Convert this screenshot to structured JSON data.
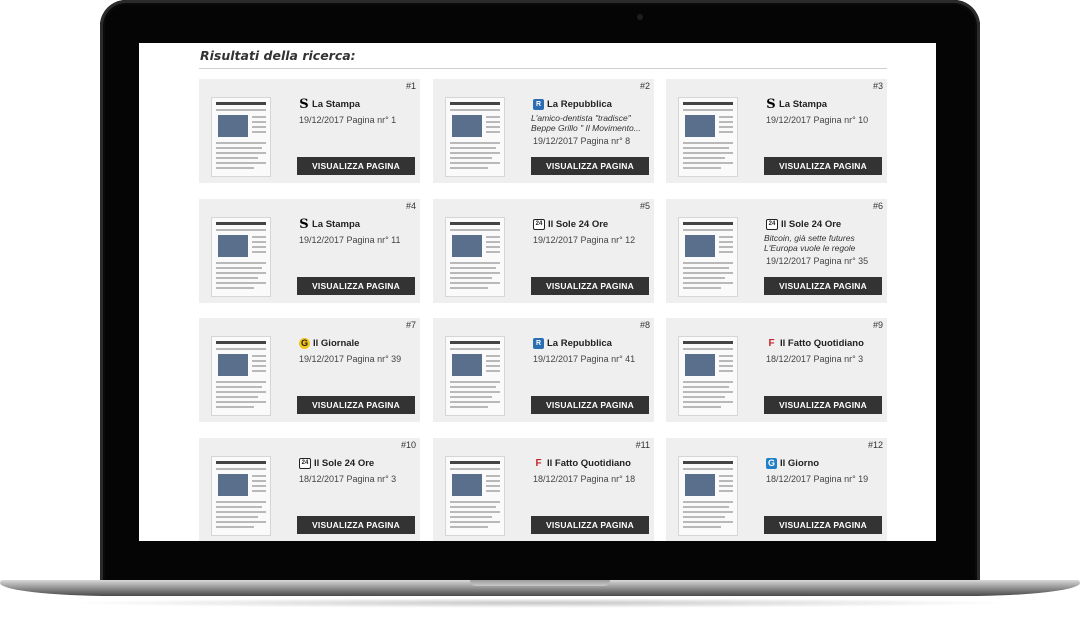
{
  "page": {
    "results_title": "Risultati della ricerca:"
  },
  "button_label": "VISUALIZZA PAGINA",
  "results": [
    {
      "num": "#1",
      "publication": "La Stampa",
      "logo": "stampa-logo",
      "excerpt": "",
      "date": "19/12/2017 Pagina nr° 1"
    },
    {
      "num": "#2",
      "publication": "La Repubblica",
      "logo": "repubblica-logo",
      "excerpt": "L'amico-dentista \"tradisce\" Beppe Grillo \" Il Movimento...",
      "date": "19/12/2017 Pagina nr° 8"
    },
    {
      "num": "#3",
      "publication": "La Stampa",
      "logo": "stampa-logo",
      "excerpt": "",
      "date": "19/12/2017 Pagina nr° 10"
    },
    {
      "num": "#4",
      "publication": "La Stampa",
      "logo": "stampa-logo",
      "excerpt": "",
      "date": "19/12/2017 Pagina nr° 11"
    },
    {
      "num": "#5",
      "publication": "Il Sole 24 Ore",
      "logo": "sole-logo",
      "excerpt": "",
      "date": "19/12/2017 Pagina nr° 12"
    },
    {
      "num": "#6",
      "publication": "Il Sole 24 Ore",
      "logo": "sole-logo",
      "excerpt": "Bitcoin, già sette futures L'Europa vuole le regole",
      "date": "19/12/2017 Pagina nr° 35"
    },
    {
      "num": "#7",
      "publication": "Il Giornale",
      "logo": "giornale-logo",
      "excerpt": "",
      "date": "19/12/2017 Pagina nr° 39"
    },
    {
      "num": "#8",
      "publication": "La Repubblica",
      "logo": "repubblica-logo",
      "excerpt": "",
      "date": "19/12/2017 Pagina nr° 41"
    },
    {
      "num": "#9",
      "publication": "Il Fatto Quotidiano",
      "logo": "fatto-logo",
      "excerpt": "",
      "date": "18/12/2017 Pagina nr° 3"
    },
    {
      "num": "#10",
      "publication": "Il Sole 24 Ore",
      "logo": "sole-logo",
      "excerpt": "",
      "date": "18/12/2017 Pagina nr° 3"
    },
    {
      "num": "#11",
      "publication": "Il Fatto Quotidiano",
      "logo": "fatto-logo",
      "excerpt": "",
      "date": "18/12/2017 Pagina nr° 18"
    },
    {
      "num": "#12",
      "publication": "Il Giorno",
      "logo": "giorno-logo",
      "excerpt": "",
      "date": "18/12/2017 Pagina nr° 19"
    }
  ],
  "logo_glyphs": {
    "stampa-logo": "S",
    "repubblica-logo": "R",
    "sole-logo": "24",
    "giornale-logo": "G",
    "fatto-logo": "F",
    "giorno-logo": "G"
  },
  "colors": {
    "button_bg": "#333333",
    "card_bg": "#efefef",
    "accent_blue": "#2a6db3"
  }
}
